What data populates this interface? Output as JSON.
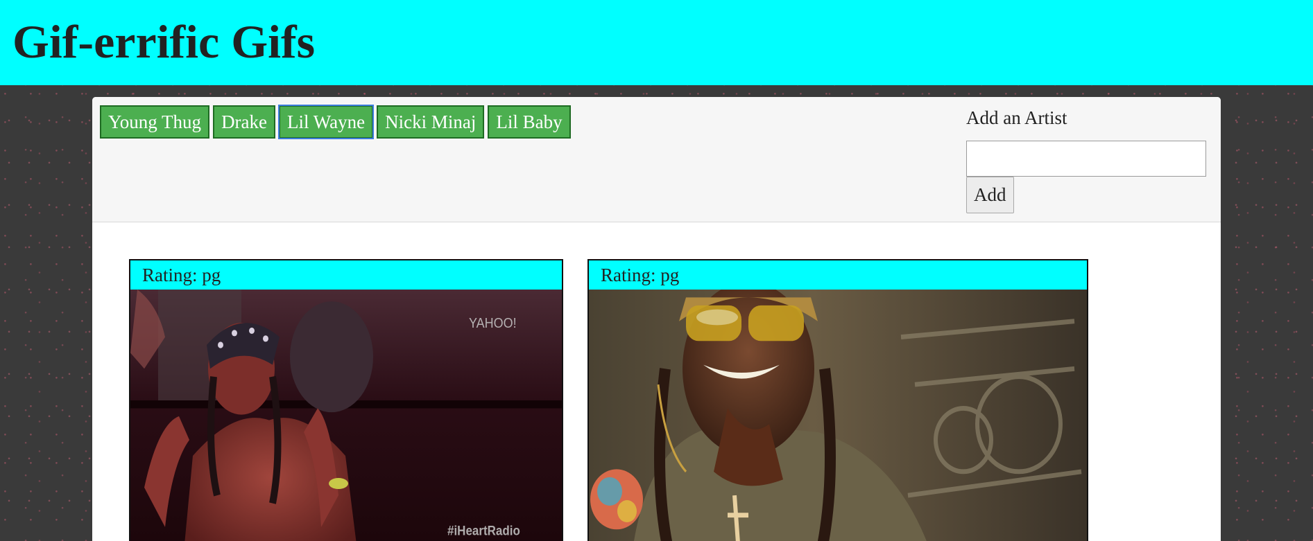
{
  "header": {
    "title": "Gif-errific Gifs"
  },
  "artists": [
    {
      "label": "Young Thug"
    },
    {
      "label": "Drake"
    },
    {
      "label": "Lil Wayne"
    },
    {
      "label": "Nicki Minaj"
    },
    {
      "label": "Lil Baby"
    }
  ],
  "add_form": {
    "label": "Add an Artist",
    "input_value": "",
    "button_label": "Add"
  },
  "gifs": [
    {
      "rating": "Rating: pg",
      "overlay_texts": [
        "YAHOO!",
        "#iHeartRadio"
      ]
    },
    {
      "rating": "Rating: pg"
    }
  ],
  "colors": {
    "header_bg": "#00ffff",
    "button_bg": "#4caf50",
    "page_bg": "#3a3a3a"
  }
}
